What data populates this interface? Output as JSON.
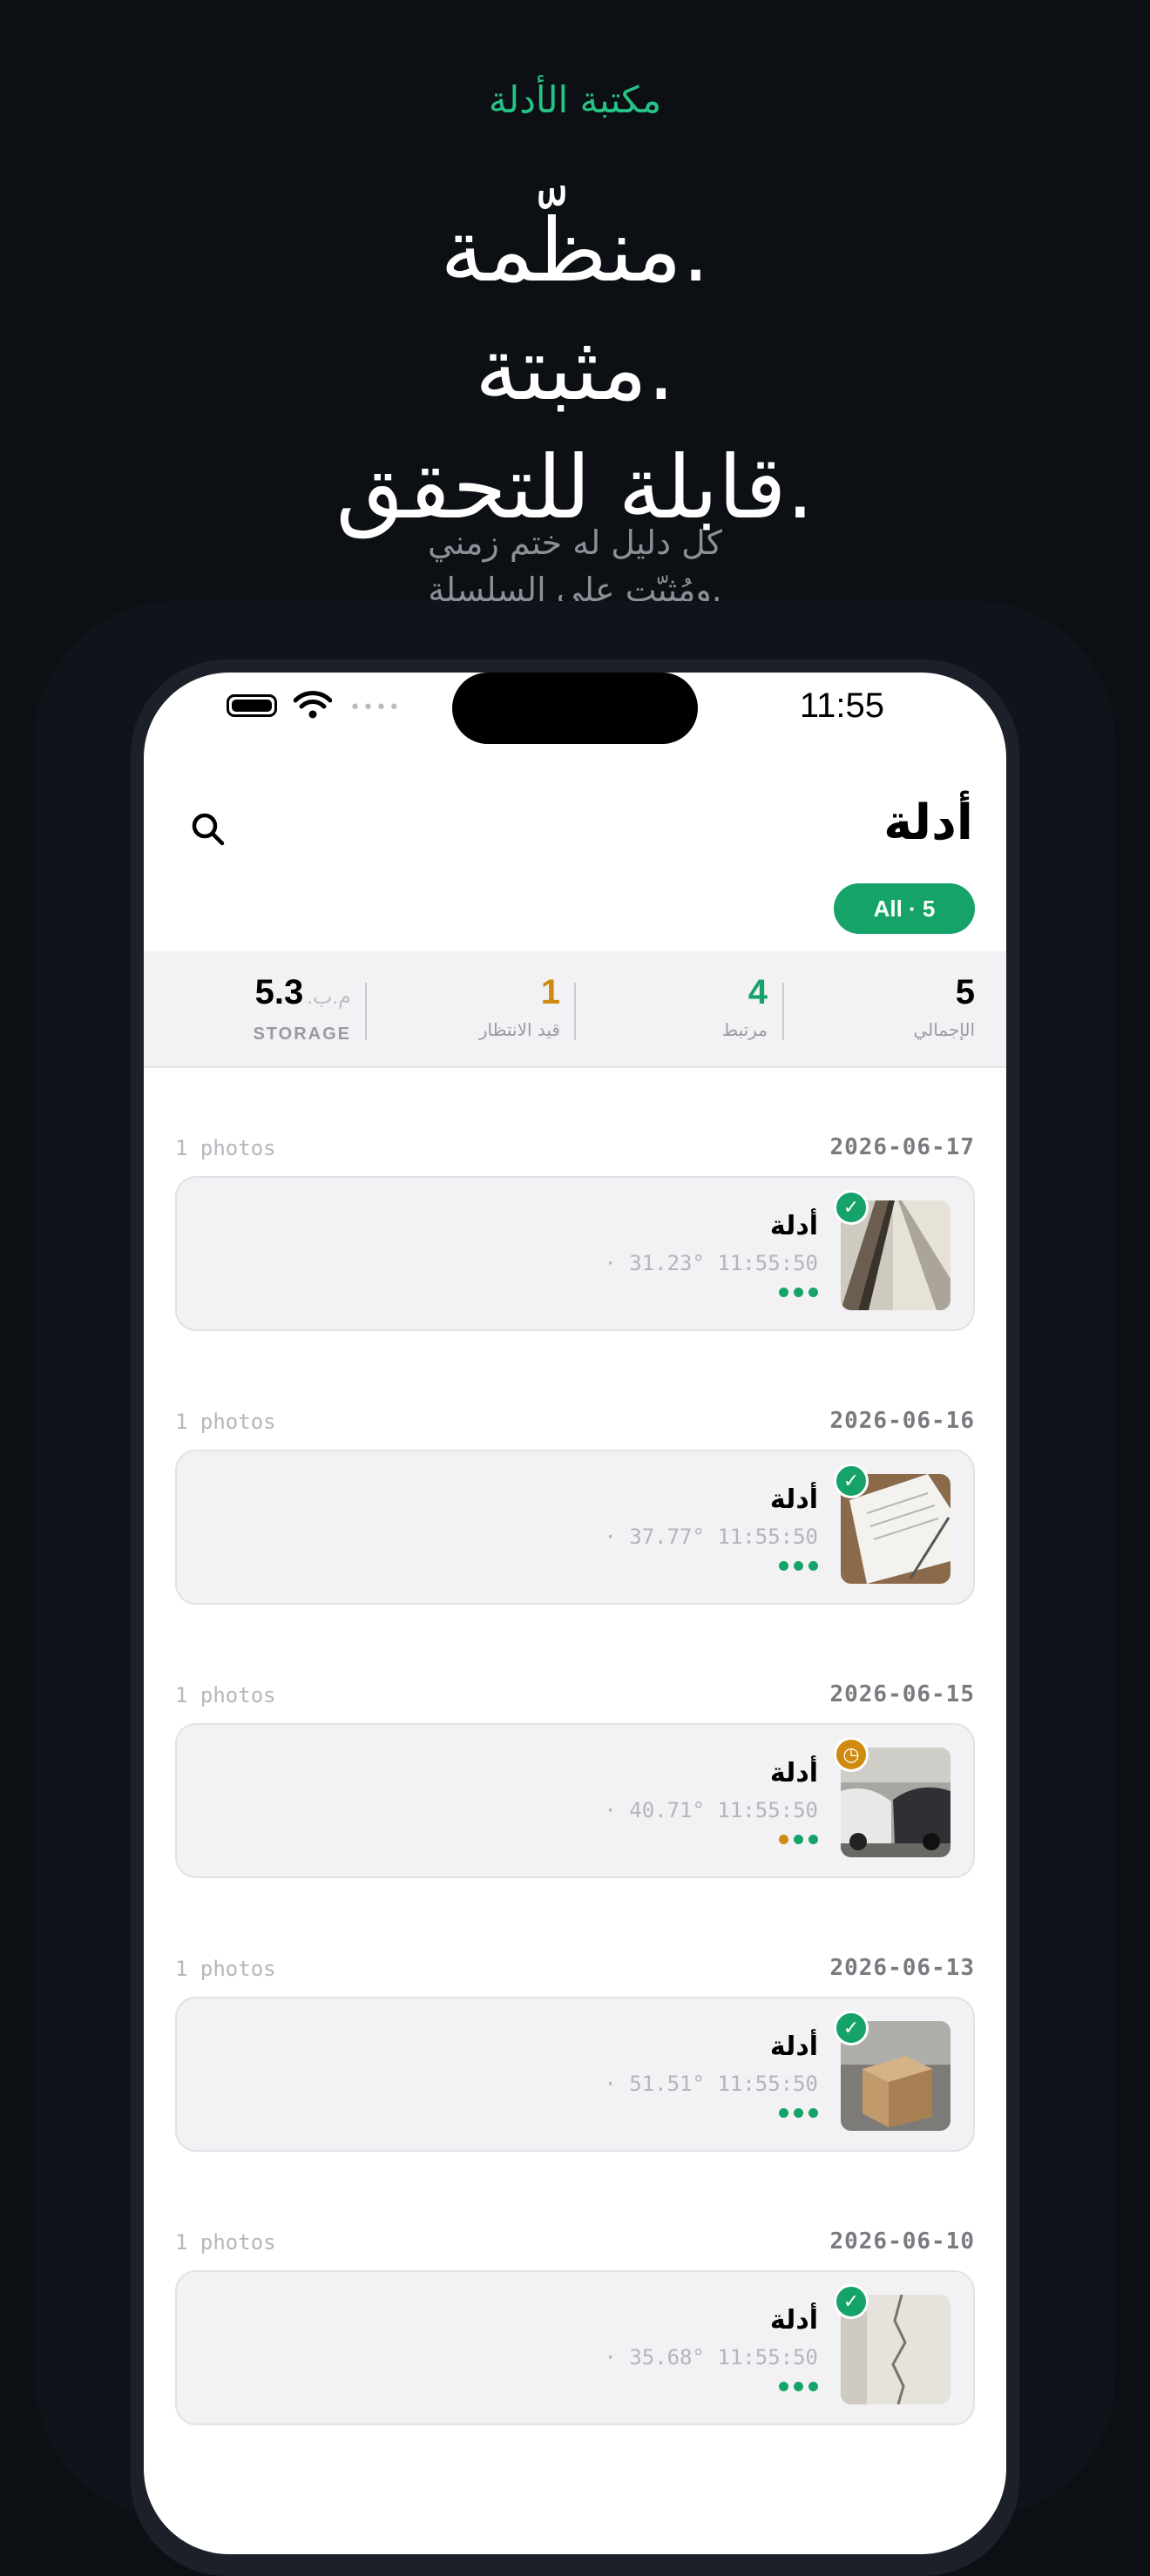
{
  "marketing": {
    "eyebrow": "مكتبة الأدلة",
    "headline": [
      "منظّمة.",
      "مثبتة.",
      "قابلة للتحقق."
    ],
    "subhead": [
      "كل دليل له ختم زمني",
      "ومُثبّت على السلسلة."
    ]
  },
  "status_bar": {
    "time": "11:55"
  },
  "header": {
    "title": "أدلة",
    "search_icon": "search-icon",
    "filter_chip": "All · 5"
  },
  "stats": {
    "total": {
      "value": "5",
      "label": "الإجمالي"
    },
    "linked": {
      "value": "4",
      "label": "مرتبط"
    },
    "pending": {
      "value": "1",
      "label": "قيد الانتظار"
    },
    "storage": {
      "value": "5.3",
      "unit": "م.ب.",
      "label": "STORAGE"
    }
  },
  "colors": {
    "accent": "#16a36a",
    "pending": "#d08a10",
    "background": "#0c0f14"
  },
  "groups": [
    {
      "date": "2026-06-17",
      "count": "1 photos",
      "title": "أدلة",
      "meta": "· 31.23° 11:55:50",
      "status": "verified"
    },
    {
      "date": "2026-06-16",
      "count": "1 photos",
      "title": "أدلة",
      "meta": "· 37.77° 11:55:50",
      "status": "verified"
    },
    {
      "date": "2026-06-15",
      "count": "1 photos",
      "title": "أدلة",
      "meta": "· 40.71° 11:55:50",
      "status": "pending"
    },
    {
      "date": "2026-06-13",
      "count": "1 photos",
      "title": "أدلة",
      "meta": "· 51.51° 11:55:50",
      "status": "verified"
    },
    {
      "date": "2026-06-10",
      "count": "1 photos",
      "title": "أدلة",
      "meta": "· 35.68° 11:55:50",
      "status": "verified"
    }
  ]
}
